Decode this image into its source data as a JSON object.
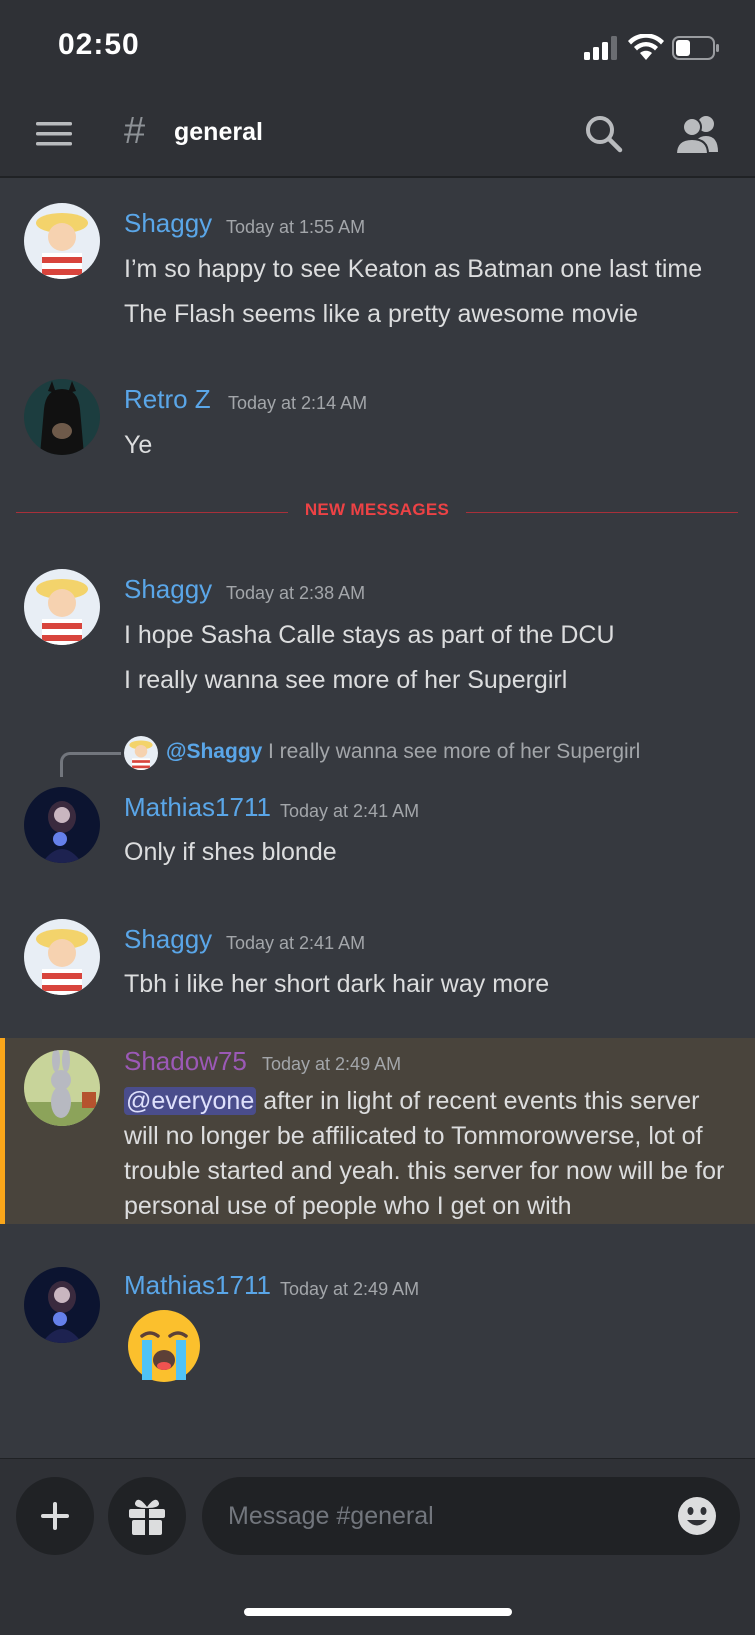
{
  "status_bar": {
    "time": "02:50"
  },
  "header": {
    "hash": "#",
    "channel_name": "general"
  },
  "messages": [
    {
      "author": "Shaggy",
      "timestamp": "Today at 1:55 AM",
      "lines": [
        "I’m so happy to see Keaton as Batman one last time",
        "The Flash seems like a pretty awesome movie"
      ]
    },
    {
      "author": "Retro Z",
      "timestamp": "Today at 2:14 AM",
      "lines": [
        "Ye"
      ]
    },
    {
      "author": "Shaggy",
      "timestamp": "Today at 2:38 AM",
      "lines": [
        "I hope Sasha Calle stays as part of the DCU",
        "I really wanna see more of her Supergirl"
      ]
    },
    {
      "author": "Mathias1711",
      "timestamp": "Today at 2:41 AM",
      "lines": [
        "Only if shes blonde"
      ],
      "reply": {
        "author": "@Shaggy",
        "text": "I really wanna see more of her Supergirl"
      }
    },
    {
      "author": "Shaggy",
      "timestamp": "Today at 2:41 AM",
      "lines": [
        "Tbh i like her short dark hair way more"
      ]
    },
    {
      "author": "Shadow75",
      "timestamp": "Today at 2:49 AM",
      "mention": "@everyone",
      "text": "after in light of recent events this server will no longer be affilicated to Tommorowverse, lot of trouble started and yeah. this server for now will be for personal use of people who I get on with"
    },
    {
      "author": "Mathias1711",
      "timestamp": "Today at 2:49 AM",
      "emoji": "loudly-crying-face"
    }
  ],
  "divider": {
    "label": "NEW MESSAGES"
  },
  "composer": {
    "placeholder": "Message #general"
  },
  "colors": {
    "background": "#36393f",
    "username_blue": "#5aa6e8",
    "username_purple": "#9b59b6",
    "new_messages_red": "#ed4245",
    "highlight_bar": "#faa61a"
  }
}
